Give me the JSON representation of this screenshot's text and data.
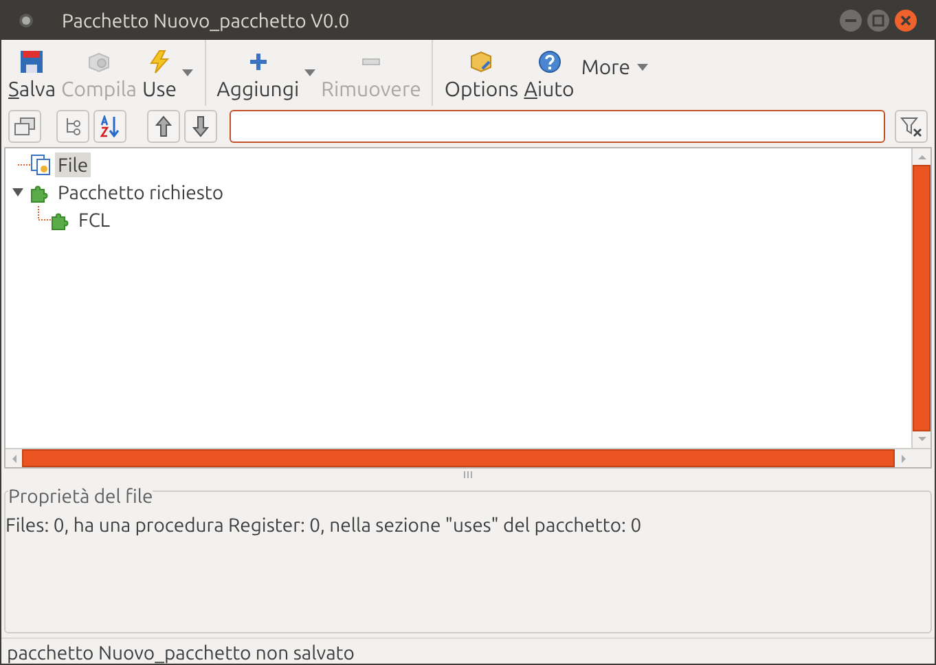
{
  "window": {
    "title": "Pacchetto Nuovo_pacchetto V0.0"
  },
  "toolbar": [
    {
      "label": "Salva",
      "kind": "button",
      "disabled": false,
      "mnemonic": true
    },
    {
      "label": "Compila",
      "kind": "button",
      "disabled": true,
      "mnemonic": false
    },
    {
      "label": "Use",
      "kind": "dropdown",
      "disabled": false,
      "mnemonic": false
    },
    {
      "label": "Aggiungi",
      "kind": "dropdown",
      "disabled": false,
      "mnemonic": false,
      "group_start": true
    },
    {
      "label": "Rimuovere",
      "kind": "button",
      "disabled": true,
      "mnemonic": false
    },
    {
      "label": "Options",
      "kind": "button",
      "disabled": false,
      "mnemonic": false,
      "group_start": true
    },
    {
      "label": "Aiuto",
      "kind": "button",
      "disabled": false,
      "mnemonic": true
    },
    {
      "label": "More",
      "kind": "menu",
      "disabled": false,
      "mnemonic": false
    }
  ],
  "tree": [
    {
      "label": "File",
      "selected": true
    },
    {
      "label": "Pacchetto richiesto",
      "selected": false,
      "expanded": true,
      "children": [
        {
          "label": "FCL",
          "selected": false
        }
      ]
    }
  ],
  "properties": {
    "title": "Proprietà del file",
    "text": "Files: 0, ha una procedura Register: 0, nella sezione \"uses\" del pacchetto: 0"
  },
  "status_bar": "pacchetto Nuovo_pacchetto non salvato"
}
